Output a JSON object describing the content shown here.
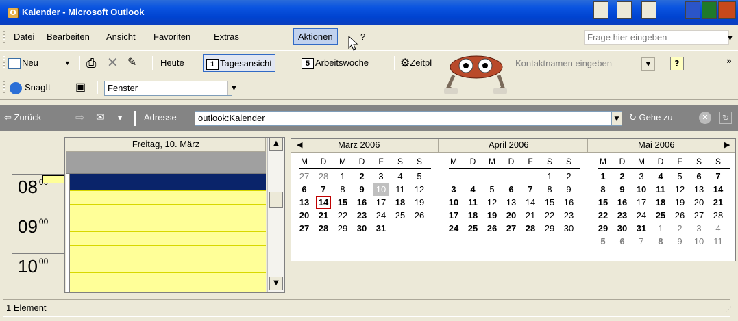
{
  "window": {
    "title": "Kalender - Microsoft Outlook",
    "app_icon_glyph": "O"
  },
  "menubar": {
    "items": [
      {
        "label": "Datei",
        "key": "datei"
      },
      {
        "label": "Bearbeiten",
        "key": "bearbeiten"
      },
      {
        "label": "Ansicht",
        "key": "ansicht"
      },
      {
        "label": "Favoriten",
        "key": "favoriten"
      },
      {
        "label": "Extras",
        "key": "extras"
      },
      {
        "label": "Aktionen",
        "key": "aktionen",
        "active": true
      },
      {
        "label": "?",
        "key": "hilfe"
      }
    ],
    "ask_placeholder": "Frage hier eingeben"
  },
  "toolbar1": {
    "new_label": "Neu",
    "today_label": "Heute",
    "day_view_label": "Tagesansicht",
    "day_view_num": "1",
    "work_week_label": "Arbeitswoche",
    "work_week_num": "5",
    "zeitplan_label": "Zeitpl",
    "contact_placeholder": "Kontaktnamen eingeben",
    "help_glyph": "?"
  },
  "toolbar2": {
    "snagit_label": "SnagIt",
    "fenster_value": "Fenster"
  },
  "addressbar": {
    "back_label": "Zurück",
    "address_label": "Adresse",
    "address_value": "outlook:Kalender",
    "goto_label": "Gehe zu"
  },
  "dayview": {
    "header": "Freitag, 10. März",
    "times": [
      {
        "hour": "08",
        "min": "00"
      },
      {
        "hour": "09",
        "min": "00"
      },
      {
        "hour": "10",
        "min": "00"
      }
    ]
  },
  "minicalendar": {
    "weekday_headers": [
      "M",
      "D",
      "M",
      "D",
      "F",
      "S",
      "S"
    ],
    "months": [
      {
        "title": "März 2006",
        "weeks": [
          [
            {
              "d": "27",
              "s": "dim"
            },
            {
              "d": "28",
              "s": "dim"
            },
            {
              "d": "1"
            },
            {
              "d": "2",
              "s": "bold"
            },
            {
              "d": "3"
            },
            {
              "d": "4"
            },
            {
              "d": "5"
            }
          ],
          [
            {
              "d": "6",
              "s": "bold"
            },
            {
              "d": "7",
              "s": "bold"
            },
            {
              "d": "8"
            },
            {
              "d": "9",
              "s": "bold"
            },
            {
              "d": "10",
              "s": "sel"
            },
            {
              "d": "11"
            },
            {
              "d": "12"
            }
          ],
          [
            {
              "d": "13",
              "s": "bold"
            },
            {
              "d": "14",
              "s": "today bold"
            },
            {
              "d": "15",
              "s": "bold"
            },
            {
              "d": "16",
              "s": "bold"
            },
            {
              "d": "17"
            },
            {
              "d": "18",
              "s": "bold"
            },
            {
              "d": "19"
            }
          ],
          [
            {
              "d": "20",
              "s": "bold"
            },
            {
              "d": "21",
              "s": "bold"
            },
            {
              "d": "22"
            },
            {
              "d": "23",
              "s": "bold"
            },
            {
              "d": "24"
            },
            {
              "d": "25"
            },
            {
              "d": "26"
            }
          ],
          [
            {
              "d": "27",
              "s": "bold"
            },
            {
              "d": "28",
              "s": "bold"
            },
            {
              "d": "29"
            },
            {
              "d": "30",
              "s": "bold"
            },
            {
              "d": "31",
              "s": "bold"
            }
          ]
        ]
      },
      {
        "title": "April 2006",
        "weeks": [
          [
            {
              "d": ""
            },
            {
              "d": ""
            },
            {
              "d": ""
            },
            {
              "d": ""
            },
            {
              "d": ""
            },
            {
              "d": "1"
            },
            {
              "d": "2"
            }
          ],
          [
            {
              "d": "3",
              "s": "bold"
            },
            {
              "d": "4",
              "s": "bold"
            },
            {
              "d": "5"
            },
            {
              "d": "6",
              "s": "bold"
            },
            {
              "d": "7",
              "s": "bold"
            },
            {
              "d": "8"
            },
            {
              "d": "9"
            }
          ],
          [
            {
              "d": "10",
              "s": "bold"
            },
            {
              "d": "11",
              "s": "bold"
            },
            {
              "d": "12"
            },
            {
              "d": "13"
            },
            {
              "d": "14"
            },
            {
              "d": "15"
            },
            {
              "d": "16"
            }
          ],
          [
            {
              "d": "17",
              "s": "bold"
            },
            {
              "d": "18",
              "s": "bold"
            },
            {
              "d": "19",
              "s": "bold"
            },
            {
              "d": "20",
              "s": "bold"
            },
            {
              "d": "21"
            },
            {
              "d": "22"
            },
            {
              "d": "23"
            }
          ],
          [
            {
              "d": "24",
              "s": "bold"
            },
            {
              "d": "25",
              "s": "bold"
            },
            {
              "d": "26",
              "s": "bold"
            },
            {
              "d": "27",
              "s": "bold"
            },
            {
              "d": "28",
              "s": "bold"
            },
            {
              "d": "29"
            },
            {
              "d": "30"
            }
          ]
        ]
      },
      {
        "title": "Mai 2006",
        "weeks": [
          [
            {
              "d": "1",
              "s": "bold"
            },
            {
              "d": "2",
              "s": "bold"
            },
            {
              "d": "3"
            },
            {
              "d": "4",
              "s": "bold"
            },
            {
              "d": "5"
            },
            {
              "d": "6",
              "s": "bold"
            },
            {
              "d": "7",
              "s": "bold"
            }
          ],
          [
            {
              "d": "8",
              "s": "bold"
            },
            {
              "d": "9",
              "s": "bold"
            },
            {
              "d": "10",
              "s": "bold"
            },
            {
              "d": "11",
              "s": "bold"
            },
            {
              "d": "12"
            },
            {
              "d": "13"
            },
            {
              "d": "14",
              "s": "bold"
            }
          ],
          [
            {
              "d": "15",
              "s": "bold"
            },
            {
              "d": "16",
              "s": "bold"
            },
            {
              "d": "17"
            },
            {
              "d": "18",
              "s": "bold"
            },
            {
              "d": "19"
            },
            {
              "d": "20"
            },
            {
              "d": "21",
              "s": "bold"
            }
          ],
          [
            {
              "d": "22",
              "s": "bold"
            },
            {
              "d": "23",
              "s": "bold"
            },
            {
              "d": "24"
            },
            {
              "d": "25",
              "s": "bold"
            },
            {
              "d": "26"
            },
            {
              "d": "27"
            },
            {
              "d": "28"
            }
          ],
          [
            {
              "d": "29",
              "s": "bold"
            },
            {
              "d": "30",
              "s": "bold"
            },
            {
              "d": "31",
              "s": "bold"
            },
            {
              "d": "1",
              "s": "dim"
            },
            {
              "d": "2",
              "s": "dim"
            },
            {
              "d": "3",
              "s": "dim"
            },
            {
              "d": "4",
              "s": "dim"
            }
          ],
          [
            {
              "d": "5",
              "s": "dim bold"
            },
            {
              "d": "6",
              "s": "dim bold"
            },
            {
              "d": "7",
              "s": "dim"
            },
            {
              "d": "8",
              "s": "dim bold"
            },
            {
              "d": "9",
              "s": "dim"
            },
            {
              "d": "10",
              "s": "dim"
            },
            {
              "d": "11",
              "s": "dim"
            }
          ]
        ]
      }
    ]
  },
  "statusbar": {
    "text": "1 Element"
  }
}
